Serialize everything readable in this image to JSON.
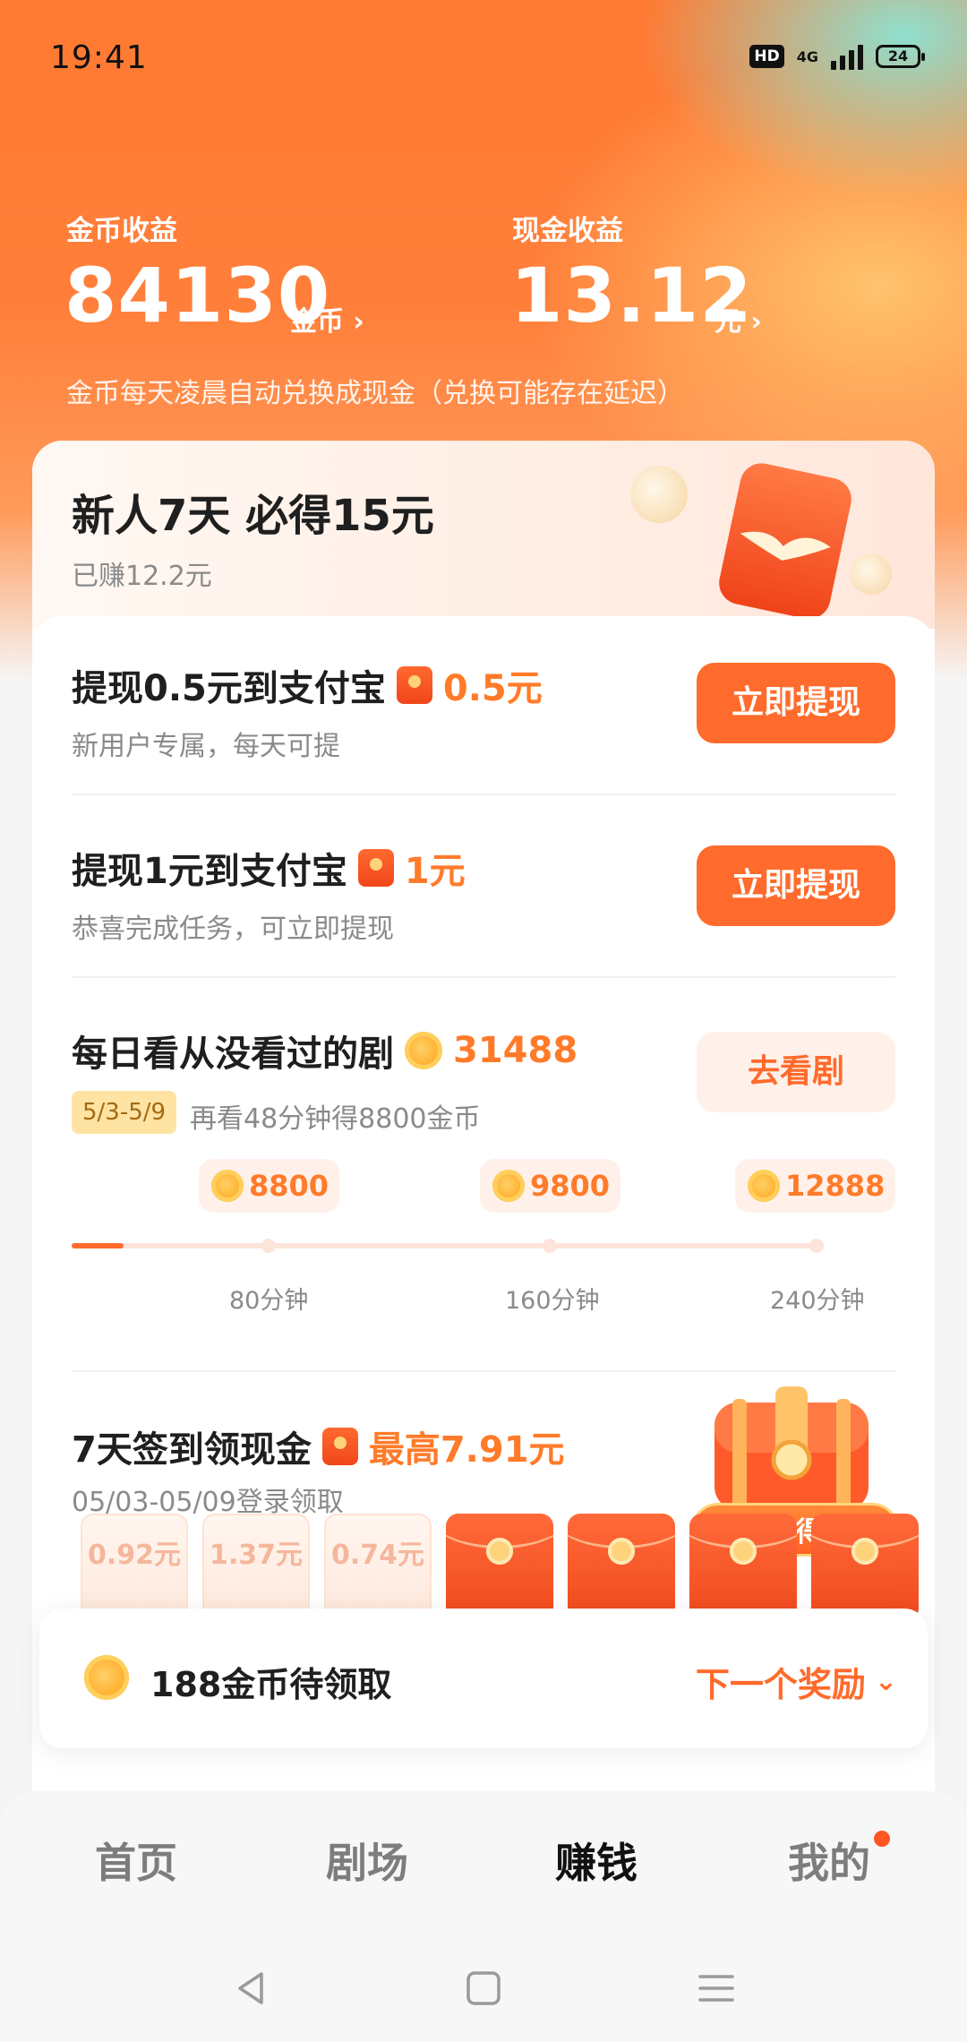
{
  "status_bar": {
    "time": "19:41",
    "hd": "HD",
    "network": "4G",
    "battery": "24"
  },
  "earnings": {
    "coin_label": "金币收益",
    "coin_value": "84130",
    "coin_unit": "金币",
    "cash_label": "现金收益",
    "cash_value": "13.12",
    "cash_unit": "元",
    "note": "金币每天凌晨自动兑换成现金（兑换可能存在延迟）"
  },
  "newbie": {
    "title": "新人7天 必得15元",
    "earned": "已赚12.2元"
  },
  "tasks": [
    {
      "title": "提现0.5元到支付宝",
      "amount": "0.5元",
      "sub": "新用户专属，每天可提",
      "button": "立即提现"
    },
    {
      "title": "提现1元到支付宝",
      "amount": "1元",
      "sub": "恭喜完成任务，可立即提现",
      "button": "立即提现"
    }
  ],
  "drama": {
    "title": "每日看从没看过的剧",
    "coins": "31488",
    "button": "去看剧",
    "date_tag": "5/3-5/9",
    "note": "再看48分钟得8800金币",
    "progress": 0.07,
    "milestones": [
      {
        "coins": "8800",
        "label": "80分钟"
      },
      {
        "coins": "9800",
        "label": "160分钟"
      },
      {
        "coins": "12888",
        "label": "240分钟"
      }
    ]
  },
  "checkin": {
    "title": "7天签到领现金",
    "amount": "最高7.91元",
    "sub": "05/03-05/09登录领取",
    "chest_label": "开宝箱得金币",
    "days": [
      "0.92元",
      "1.37元",
      "0.74元"
    ]
  },
  "pending": {
    "text": "188金币待领取",
    "next": "下一个奖励"
  },
  "tabs": [
    {
      "label": "首页"
    },
    {
      "label": "剧场"
    },
    {
      "label": "赚钱"
    },
    {
      "label": "我的"
    }
  ],
  "colors": {
    "accent": "#ff6b2c",
    "hero": "#ff7a32"
  }
}
